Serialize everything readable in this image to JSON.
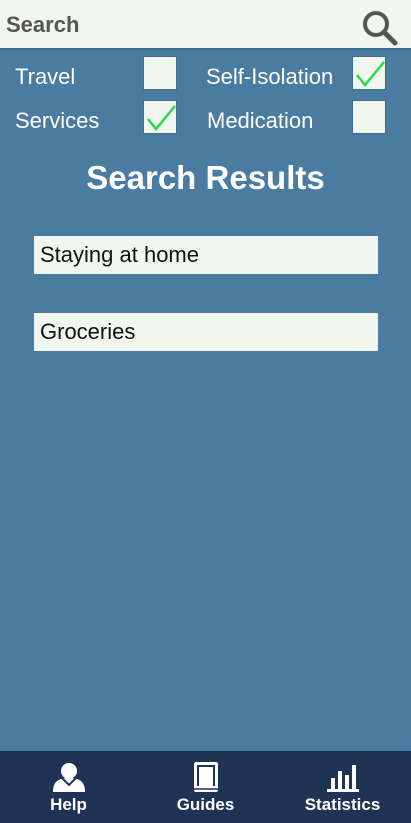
{
  "search": {
    "placeholder": "Search",
    "value": ""
  },
  "filters": [
    {
      "label": "Travel",
      "checked": false
    },
    {
      "label": "Self-Isolation",
      "checked": true
    },
    {
      "label": "Services",
      "checked": true
    },
    {
      "label": "Medication",
      "checked": false
    }
  ],
  "results": {
    "title": "Search Results",
    "items": [
      {
        "label": "Staying at home"
      },
      {
        "label": "Groceries"
      }
    ]
  },
  "nav": {
    "items": [
      {
        "label": "Help",
        "icon": "user-icon"
      },
      {
        "label": "Guides",
        "icon": "book-icon"
      },
      {
        "label": "Statistics",
        "icon": "bar-chart-icon"
      }
    ]
  },
  "colors": {
    "background": "#4a7ba1",
    "field": "#f1f7ee",
    "nav": "#1f3454",
    "check": "#2bd84a"
  }
}
